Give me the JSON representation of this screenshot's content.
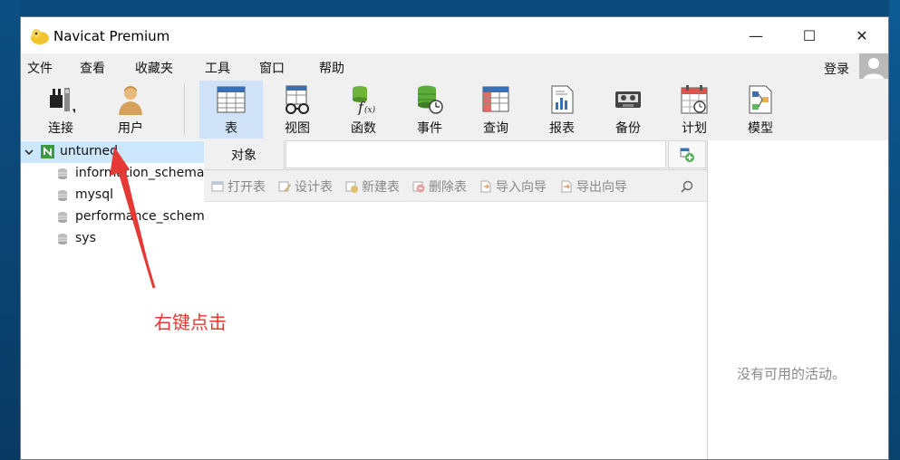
{
  "window": {
    "title": "Navicat Premium",
    "minimize": "—",
    "maximize": "☐",
    "close": "✕"
  },
  "menu": {
    "items": [
      "文件",
      "查看",
      "收藏夹",
      "工具",
      "窗口",
      "帮助"
    ],
    "login": "登录"
  },
  "toolbar": {
    "connect": "连接",
    "user": "用户",
    "table": "表",
    "view": "视图",
    "function": "函数",
    "event": "事件",
    "query": "查询",
    "report": "报表",
    "backup": "备份",
    "schedule": "计划",
    "model": "模型"
  },
  "tree": {
    "connection": "unturned",
    "databases": [
      "information_schema",
      "mysql",
      "performance_schema",
      "sys"
    ]
  },
  "objects": {
    "tab_label": "对象",
    "actions": {
      "open": "打开表",
      "design": "设计表",
      "new": "新建表",
      "delete": "删除表",
      "import": "导入向导",
      "export": "导出向导"
    }
  },
  "activity": {
    "empty": "没有可用的活动。"
  },
  "annotation": {
    "text": "右键点击",
    "color": "#e53935"
  }
}
